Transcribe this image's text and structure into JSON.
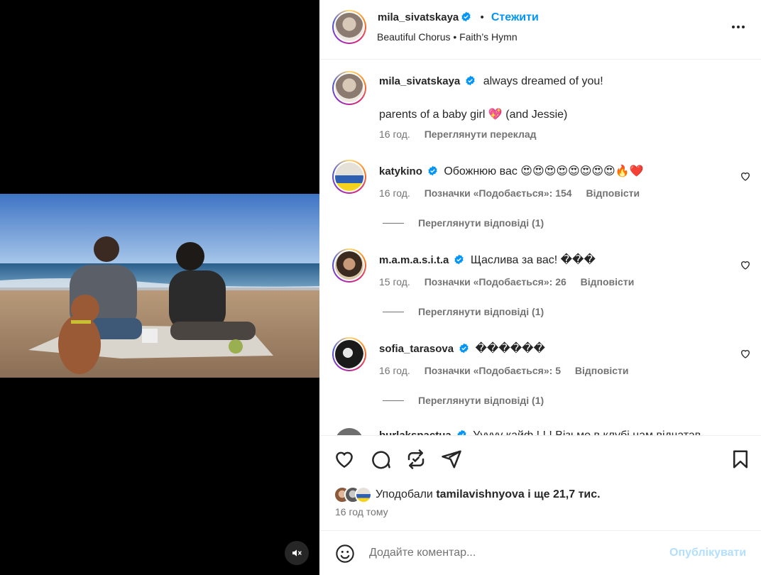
{
  "post": {
    "author": "mila_sivatskaya",
    "follow_label": "Стежити",
    "dot": "•",
    "music": "Beautiful Chorus • Faith’s Hymn",
    "more_label": "More options"
  },
  "caption": {
    "username": "mila_sivatskaya",
    "text_line1": "always dreamed of you!",
    "text_line2": "parents of a baby girl 💖 (and Jessie)",
    "time": "16 год.",
    "translate_label": "Переглянути переклад"
  },
  "comments": [
    {
      "username": "katykino",
      "text": "Обожнюю вас 😍😍😍😍😍😍😍😍🔥❤️",
      "time": "16 год.",
      "likes_label": "Позначки «Подобається»: 154",
      "reply_label": "Відповісти",
      "view_replies": "Переглянути відповіді (1)"
    },
    {
      "username": "m.a.m.a.s.i.t.a",
      "text": "Щаслива за вас! ���",
      "time": "15 год.",
      "likes_label": "Позначки «Подобається»: 26",
      "reply_label": "Відповісти",
      "view_replies": "Переглянути відповіді (1)"
    },
    {
      "username": "sofia_tarasova",
      "text": "������",
      "time": "16 год.",
      "likes_label": "Позначки «Подобається»: 5",
      "reply_label": "Відповісти",
      "view_replies": "Переглянути відповіді (1)"
    },
    {
      "username": "burlakspactua",
      "text": "Ууууу кайф ! ! ! Візьмо в клубі нам відчатав"
    }
  ],
  "likes": {
    "prefix": "Уподобали",
    "user": "tamilavishnyova",
    "suffix": "і ще 21,7 тис."
  },
  "posted_ago": "16 год тому",
  "comment_box": {
    "placeholder": "Додайте коментар...",
    "publish_label": "Опублікувати"
  },
  "colors": {
    "accent": "#0095f6",
    "publish_disabled": "#b2dffc",
    "secondary_text": "#737373"
  }
}
